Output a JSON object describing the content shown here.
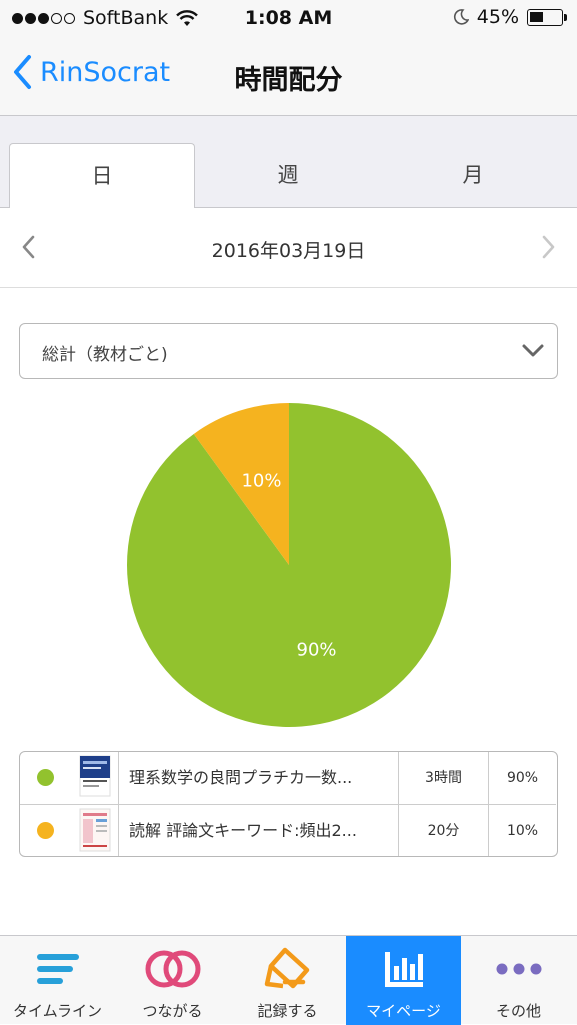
{
  "status": {
    "carrier": "SoftBank",
    "time": "1:08 AM",
    "battery": "45%",
    "signal_bars": 3,
    "signal_total": 5,
    "battery_level": 0.45
  },
  "nav": {
    "back_label": "RinSocrat",
    "title": "時間配分"
  },
  "tabs": [
    {
      "label": "日",
      "active": true
    },
    {
      "label": "週",
      "active": false
    },
    {
      "label": "月",
      "active": false
    }
  ],
  "date": {
    "label": "2016年03月19日"
  },
  "filter": {
    "selected": "総計（教材ごと)"
  },
  "chart_data": {
    "type": "pie",
    "slices": [
      {
        "label": "90%",
        "value": 90,
        "color": "#92c22e"
      },
      {
        "label": "10%",
        "value": 10,
        "color": "#f5b31f"
      }
    ]
  },
  "table": {
    "rows": [
      {
        "color": "#92c22e",
        "name": "理系数学の良問プラチカ一数...",
        "time": "3時間",
        "percent": "90%"
      },
      {
        "color": "#f5b31f",
        "name": "読解 評論文キーワード:頻出2...",
        "time": "20分",
        "percent": "10%"
      }
    ]
  },
  "bottom_tabs": [
    {
      "label": "タイムライン",
      "icon": "timeline-icon",
      "active": false
    },
    {
      "label": "つながる",
      "icon": "connect-rings-icon",
      "active": false
    },
    {
      "label": "記録する",
      "icon": "record-pencil-icon",
      "active": false
    },
    {
      "label": "マイページ",
      "icon": "bar-chart-icon",
      "active": true
    },
    {
      "label": "その他",
      "icon": "more-dots-icon",
      "active": false
    }
  ],
  "colors": {
    "accent": "#1a8cff",
    "green": "#92c22e",
    "orange": "#f5b31f",
    "pink": "#e04a7a",
    "purple": "#7a6cc0"
  }
}
